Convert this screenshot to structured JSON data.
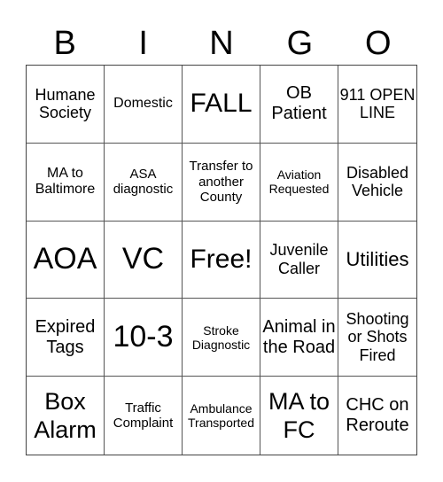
{
  "header": [
    "B",
    "I",
    "N",
    "G",
    "O"
  ],
  "cells": [
    "Humane Society",
    "Domestic",
    "FALL",
    "OB Patient",
    "911 OPEN LINE",
    "MA to Baltimore",
    "ASA diagnostic",
    "Transfer to another County",
    "Aviation Requested",
    "Disabled Vehicle",
    "AOA",
    "VC",
    "Free!",
    "Juvenile Caller",
    "Utilities",
    "Expired Tags",
    "10-3",
    "Stroke Diagnostic",
    "Animal in the Road",
    "Shooting or Shots Fired",
    "Box Alarm",
    "Traffic Complaint",
    "Ambulance Transported",
    "MA to FC",
    "CHC on Reroute"
  ]
}
